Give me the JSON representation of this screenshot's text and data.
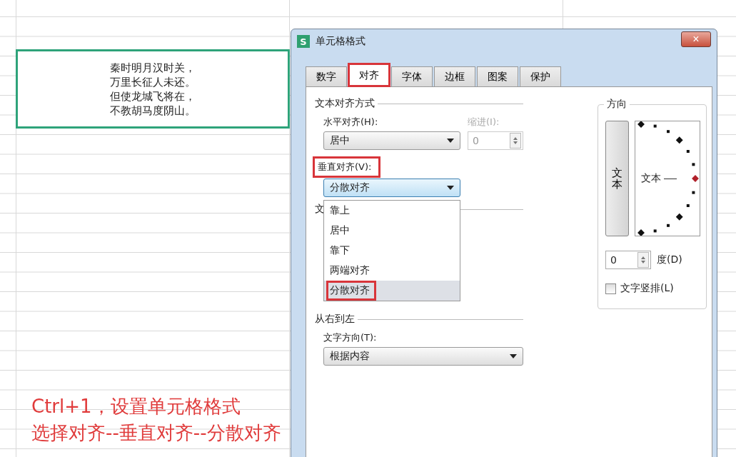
{
  "spreadsheet": {
    "cell_lines": [
      "秦时明月汉时关，",
      "万里长征人未还。",
      "但使龙城飞将在，",
      "不教胡马度阴山。"
    ]
  },
  "dialog": {
    "title": "单元格格式",
    "icon_letter": "S",
    "close": "×",
    "tabs": [
      {
        "label": "数字",
        "selected": false,
        "highlighted": false
      },
      {
        "label": "对齐",
        "selected": true,
        "highlighted": true
      },
      {
        "label": "字体",
        "selected": false,
        "highlighted": false
      },
      {
        "label": "边框",
        "selected": false,
        "highlighted": false
      },
      {
        "label": "图案",
        "selected": false,
        "highlighted": false
      },
      {
        "label": "保护",
        "selected": false,
        "highlighted": false
      }
    ],
    "alignment": {
      "heading": "文本对齐方式",
      "horizontal": {
        "label": "水平对齐(H):",
        "value": "居中"
      },
      "indent": {
        "label": "缩进(I):",
        "value": "0",
        "disabled": true
      },
      "vertical": {
        "label": "垂直对齐(V):",
        "label_highlighted": true,
        "value": "分散对齐",
        "expanded": true,
        "options": [
          {
            "label": "靠上",
            "selected": false,
            "highlighted": false
          },
          {
            "label": "居中",
            "selected": false,
            "highlighted": false
          },
          {
            "label": "靠下",
            "selected": false,
            "highlighted": false
          },
          {
            "label": "两端对齐",
            "selected": false,
            "highlighted": false
          },
          {
            "label": "分散对齐",
            "selected": true,
            "highlighted": true
          }
        ]
      }
    },
    "text_control": {
      "heading": "文"
    },
    "right_to_left": {
      "heading": "从右到左",
      "direction": {
        "label": "文字方向(T):",
        "value": "根据内容"
      }
    },
    "orientation": {
      "heading": "方向",
      "vertical_button": "文本",
      "dial_text": "文本",
      "degrees": {
        "value": "0",
        "label": "度(D)"
      },
      "vertical_stack": {
        "label": "文字竖排(L)",
        "checked": false
      }
    }
  },
  "caption": [
    "Ctrl+1，设置单元格格式",
    "选择对齐--垂直对齐--分散对齐"
  ]
}
